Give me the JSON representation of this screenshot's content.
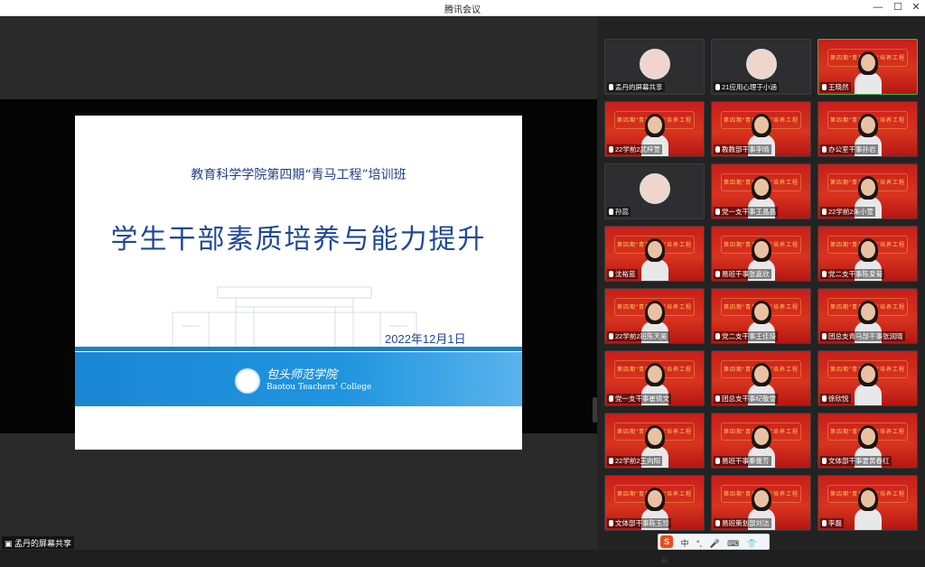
{
  "window": {
    "title": "腾讯会议",
    "controls": [
      "—",
      "☐",
      "✕"
    ]
  },
  "share": {
    "slide": {
      "subtitle": "教育科学学院第四期“青马工程”培训班",
      "title": "学生干部素质培养与能力提升",
      "date": "2022年12月1日",
      "college_cn": "包头师范学院",
      "college_en": "Baotou Teachers’ College"
    },
    "label": "孟丹的屏幕共享"
  },
  "participants": [
    {
      "name": "孟丹的屏幕共享",
      "type": "avatar"
    },
    {
      "name": "21应用心理于小涵",
      "type": "avatar"
    },
    {
      "name": "王晓然",
      "type": "video",
      "active": true
    },
    {
      "name": "22学前2武梓萱",
      "type": "video"
    },
    {
      "name": "教教部干事李晴",
      "type": "video"
    },
    {
      "name": "办公室干事孙岩",
      "type": "video"
    },
    {
      "name": "孙蕊",
      "type": "avatar"
    },
    {
      "name": "党一支干事王晶晶",
      "type": "video"
    },
    {
      "name": "22学前2朱小萱",
      "type": "video"
    },
    {
      "name": "沈裕蓝",
      "type": "video"
    },
    {
      "name": "易班干事张嘉欣",
      "type": "video"
    },
    {
      "name": "党二支干事陈爱菊",
      "type": "video"
    },
    {
      "name": "22学前2班陈天昊",
      "type": "video"
    },
    {
      "name": "党二支干事王佳琦",
      "type": "video"
    },
    {
      "name": "团总支青马部干事张润晓",
      "type": "video"
    },
    {
      "name": "党一支干事崔倩文",
      "type": "video"
    },
    {
      "name": "团总支干事纪敬雪",
      "type": "video"
    },
    {
      "name": "徐欣悦",
      "type": "video"
    },
    {
      "name": "22学前2王向阳",
      "type": "video"
    },
    {
      "name": "易班干事秦蕾芳",
      "type": "video"
    },
    {
      "name": "文体部干事要黄春红",
      "type": "video"
    },
    {
      "name": "文体部干事陈玉珍",
      "type": "video"
    },
    {
      "name": "易班策划部刘洁",
      "type": "video"
    },
    {
      "name": "李磊",
      "type": "video"
    }
  ],
  "banner_text": "第四期“青马工程”培养工程",
  "ime": {
    "logo": "S",
    "items": [
      "中",
      "°,",
      "🎤",
      "⌨",
      "👕",
      "▦"
    ]
  }
}
